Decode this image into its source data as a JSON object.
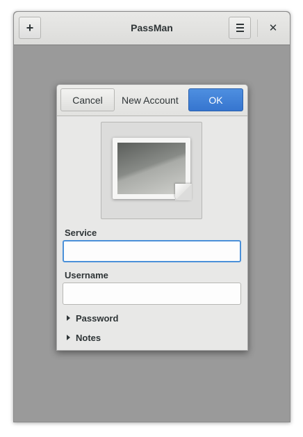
{
  "window": {
    "title": "PassMan",
    "add_button": "+",
    "close_button": "✕"
  },
  "dialog": {
    "title": "New Account",
    "cancel_label": "Cancel",
    "ok_label": "OK",
    "service_label": "Service",
    "service_value": "",
    "username_label": "Username",
    "username_value": "",
    "password_expander": "Password",
    "notes_expander": "Notes"
  },
  "colors": {
    "accent": "#3a7bd5",
    "backdrop": "#9a9a9a",
    "focus_ring": "#4a90d9"
  },
  "icons": {
    "add": "plus-icon",
    "menu": "hamburger-menu-icon",
    "close": "close-icon",
    "image_placeholder": "image-missing-icon",
    "expander": "triangle-right-icon"
  }
}
